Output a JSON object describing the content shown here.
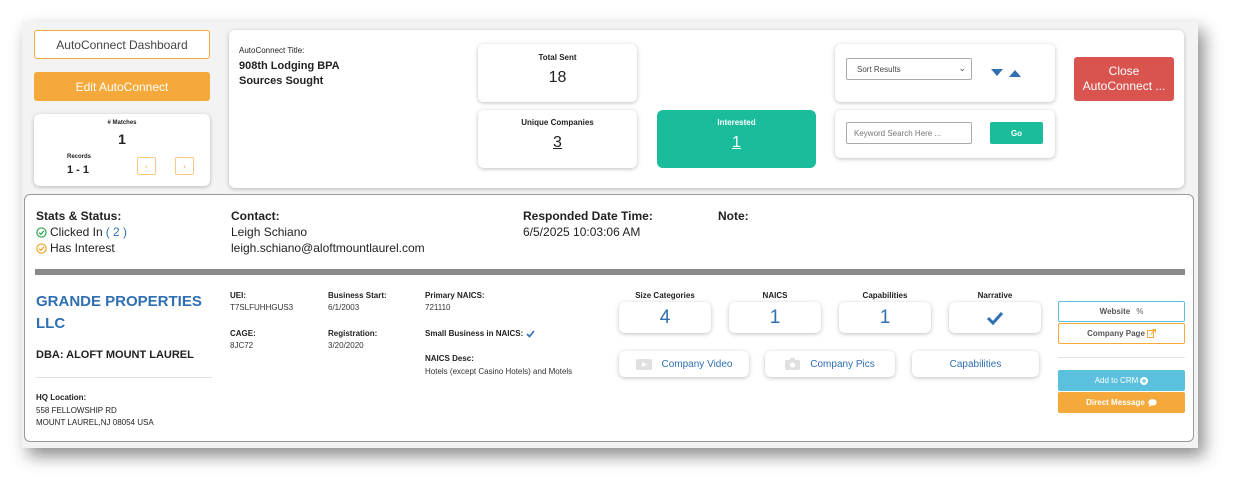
{
  "left_panel": {
    "dashboard_button": "AutoConnect Dashboard",
    "edit_button": "Edit AutoConnect",
    "matches_label": "# Matches",
    "matches_value": "1",
    "records_label": "Records",
    "records_value": "1 - 1",
    "prev_label": "‹",
    "next_label": "›"
  },
  "title_card": {
    "label": "AutoConnect Title:",
    "line1": "908th Lodging BPA",
    "line2": "Sources Sought"
  },
  "stats": {
    "total_sent_label": "Total Sent",
    "total_sent_value": "18",
    "unique_label": "Unique Companies",
    "unique_value": "3",
    "interested_label": "Interested",
    "interested_value": "1"
  },
  "controls": {
    "sort_selected": "Sort Results",
    "search_placeholder": "Keyword Search Here ...",
    "go_label": "Go",
    "close_label": "Close AutoConnect ..."
  },
  "status": {
    "stats_label": "Stats & Status:",
    "clicked_text": "Clicked In",
    "clicked_count": "( 2 )",
    "interest_text": "Has Interest",
    "contact_label": "Contact:",
    "contact_name": "Leigh Schiano",
    "contact_email": "leigh.schiano@aloftmountlaurel.com",
    "responded_label": "Responded Date Time:",
    "responded_value": "6/5/2025 10:03:06 AM",
    "note_label": "Note:"
  },
  "company": {
    "name": "GRANDE PROPERTIES LLC",
    "dba": "DBA: ALOFT MOUNT LAUREL",
    "hq_label": "HQ Location:",
    "hq_line1": "558 FELLOWSHIP RD",
    "hq_line2": "MOUNT LAUREL,NJ 08054 USA",
    "uei_label": "UEI:",
    "uei_value": "T7SLFUHHGUS3",
    "cage_label": "CAGE:",
    "cage_value": "8JC72",
    "business_start_label": "Business Start:",
    "business_start_value": "6/1/2003",
    "registration_label": "Registration:",
    "registration_value": "3/20/2020",
    "primary_naics_label": "Primary NAICS:",
    "primary_naics_value": "721110",
    "small_business_label": "Small Business in NAICS:",
    "naics_desc_label": "NAICS Desc:",
    "naics_desc_value": "Hotels (except Casino Hotels) and Motels"
  },
  "metrics": {
    "size_label": "Size Categories",
    "size_value": "4",
    "naics_label": "NAICS",
    "naics_value": "1",
    "capabilities_label": "Capabilities",
    "capabilities_value": "1",
    "narrative_label": "Narrative"
  },
  "media": {
    "video_label": "Company Video",
    "pics_label": "Company Pics",
    "capabilities_label": "Capabilities"
  },
  "actions": {
    "website_label": "Website",
    "company_page_label": "Company Page",
    "add_crm_label": "Add to CRM",
    "direct_message_label": "Direct Message"
  },
  "colors": {
    "orange": "#f5a93a",
    "teal": "#1abc9c",
    "red": "#d9534f",
    "blue": "#2f6fb2",
    "light_blue": "#5bc0de"
  }
}
